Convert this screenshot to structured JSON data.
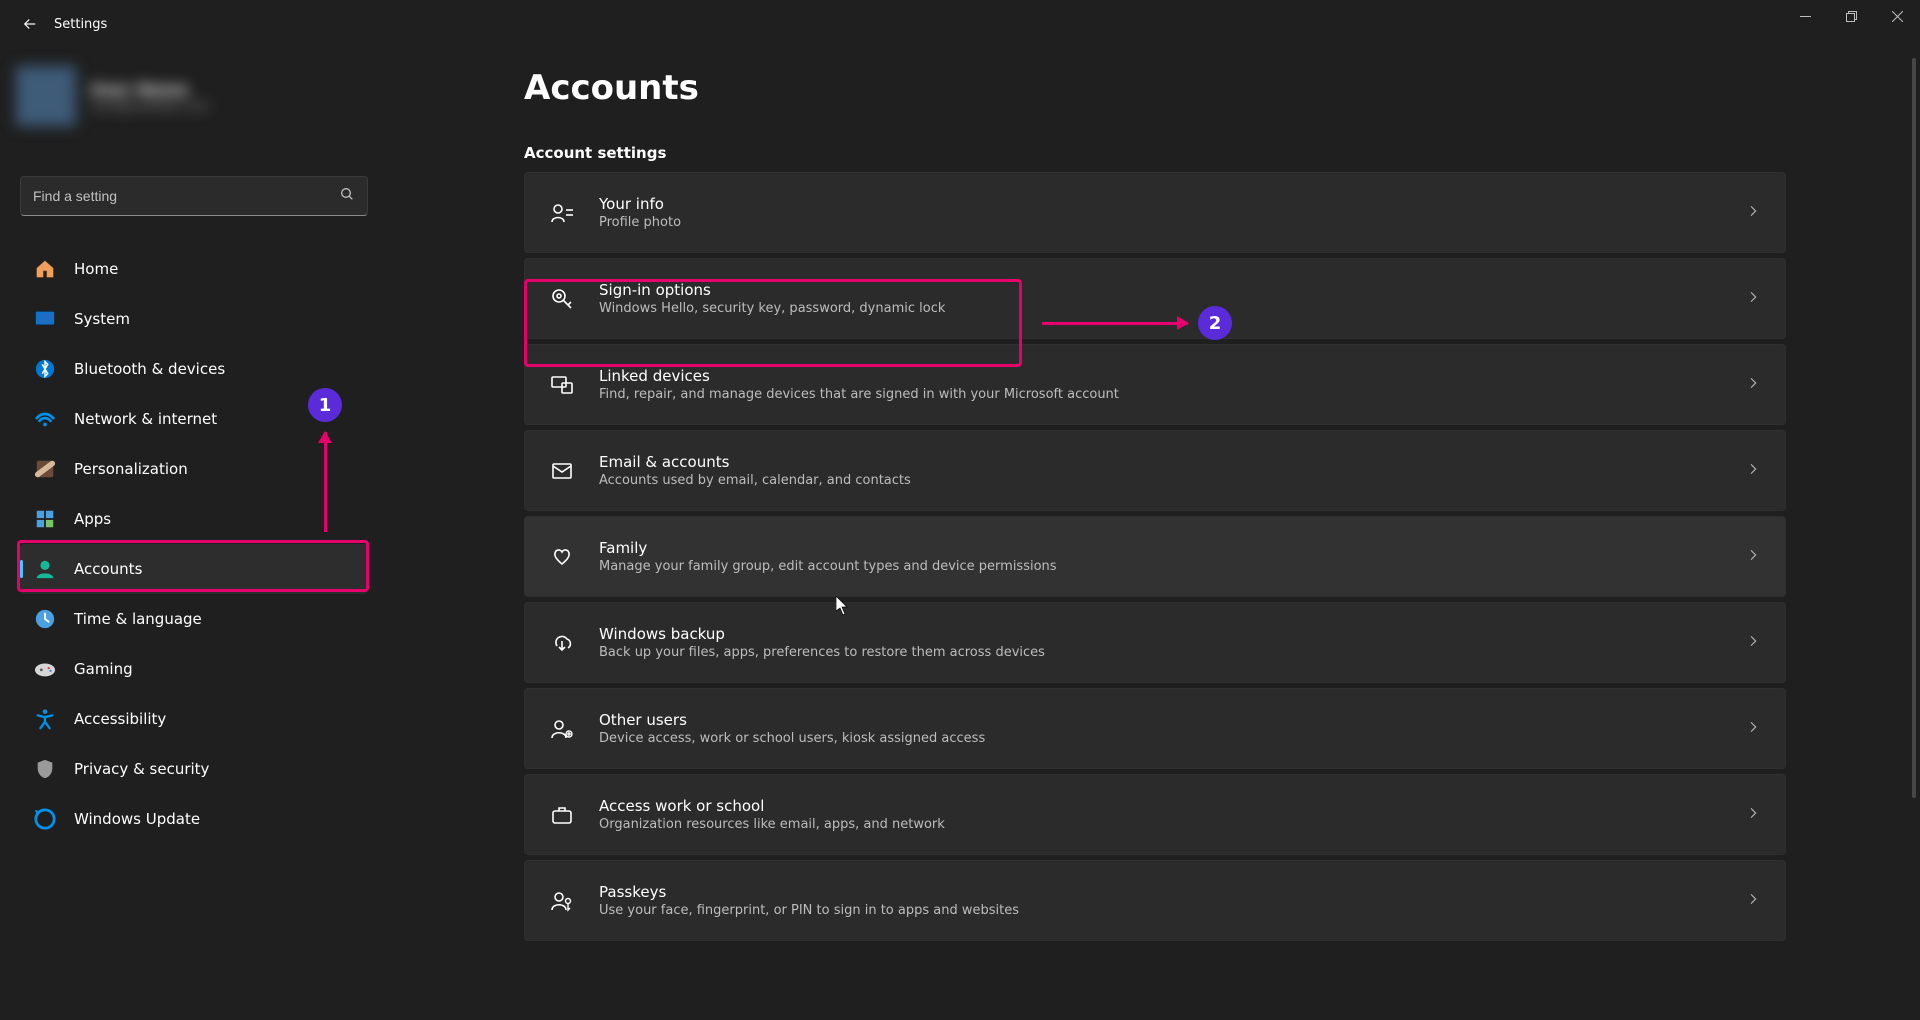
{
  "window": {
    "title": "Settings"
  },
  "user": {
    "name": "User Name",
    "email": "user@example.com"
  },
  "search": {
    "placeholder": "Find a setting"
  },
  "sidebar": {
    "items": [
      {
        "icon": "home-icon",
        "label": "Home"
      },
      {
        "icon": "system-icon",
        "label": "System"
      },
      {
        "icon": "bluetooth-icon",
        "label": "Bluetooth & devices"
      },
      {
        "icon": "wifi-icon",
        "label": "Network & internet"
      },
      {
        "icon": "personalization-icon",
        "label": "Personalization"
      },
      {
        "icon": "apps-icon",
        "label": "Apps"
      },
      {
        "icon": "accounts-icon",
        "label": "Accounts",
        "selected": true
      },
      {
        "icon": "time-icon",
        "label": "Time & language"
      },
      {
        "icon": "gaming-icon",
        "label": "Gaming"
      },
      {
        "icon": "accessibility-icon",
        "label": "Accessibility"
      },
      {
        "icon": "privacy-icon",
        "label": "Privacy & security"
      },
      {
        "icon": "update-icon",
        "label": "Windows Update"
      }
    ]
  },
  "page": {
    "title": "Accounts",
    "section": "Account settings",
    "cards": [
      {
        "icon": "your-info-icon",
        "title": "Your info",
        "desc": "Profile photo"
      },
      {
        "icon": "signin-icon",
        "title": "Sign-in options",
        "desc": "Windows Hello, security key, password, dynamic lock"
      },
      {
        "icon": "linked-icon",
        "title": "Linked devices",
        "desc": "Find, repair, and manage devices that are signed in with your Microsoft account"
      },
      {
        "icon": "email-icon",
        "title": "Email & accounts",
        "desc": "Accounts used by email, calendar, and contacts"
      },
      {
        "icon": "family-icon",
        "title": "Family",
        "desc": "Manage your family group, edit account types and device permissions",
        "hover": true
      },
      {
        "icon": "backup-icon",
        "title": "Windows backup",
        "desc": "Back up your files, apps, preferences to restore them across devices"
      },
      {
        "icon": "users-icon",
        "title": "Other users",
        "desc": "Device access, work or school users, kiosk assigned access"
      },
      {
        "icon": "work-icon",
        "title": "Access work or school",
        "desc": "Organization resources like email, apps, and network"
      },
      {
        "icon": "passkeys-icon",
        "title": "Passkeys",
        "desc": "Use your face, fingerprint, or PIN to sign in to apps and websites"
      }
    ]
  },
  "annotations": {
    "badge1": "1",
    "badge2": "2"
  }
}
